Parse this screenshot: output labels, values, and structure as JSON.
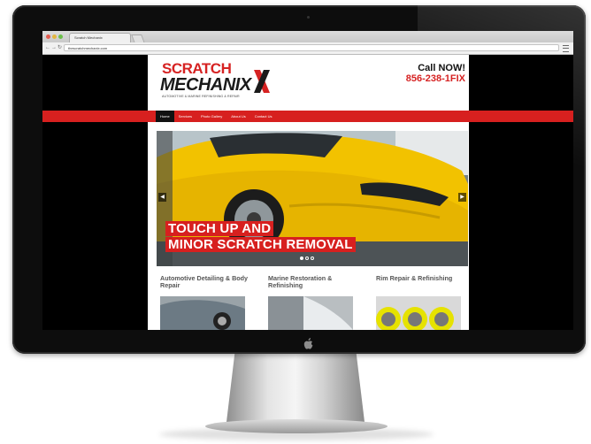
{
  "browser": {
    "tab_title": "Scratch Mechanix",
    "url": "thescratchmechanix.com"
  },
  "site": {
    "logo_line1": "SCRATCH",
    "logo_line2": "MECHANIX",
    "logo_tagline": "AUTOMOTIVE & MARINE REFINISHING & REPAIR",
    "call_label": "Call NOW!",
    "phone": "856-238-1FIX",
    "nav": [
      {
        "label": "Home",
        "active": true
      },
      {
        "label": "Services",
        "active": false
      },
      {
        "label": "Photo Gallery",
        "active": false
      },
      {
        "label": "About Us",
        "active": false
      },
      {
        "label": "Contact Us",
        "active": false
      }
    ],
    "slider": {
      "line1": "TOUCH UP AND",
      "line2": "MINOR SCRATCH REMOVAL",
      "slide_count": 3,
      "current_slide": 1
    },
    "cards": [
      {
        "title": "Automotive Detailing & Body Repair"
      },
      {
        "title": "Marine Restoration & Refinishing"
      },
      {
        "title": "Rim Repair & Refinishing"
      }
    ]
  },
  "colors": {
    "brand_red": "#d7201f",
    "car_yellow": "#f4c400",
    "bezel": "#0d0d0d"
  },
  "icons": [
    "apple-logo-icon",
    "back-arrow-icon",
    "forward-arrow-icon",
    "reload-icon",
    "menu-icon",
    "chevron-left-icon",
    "chevron-right-icon"
  ]
}
